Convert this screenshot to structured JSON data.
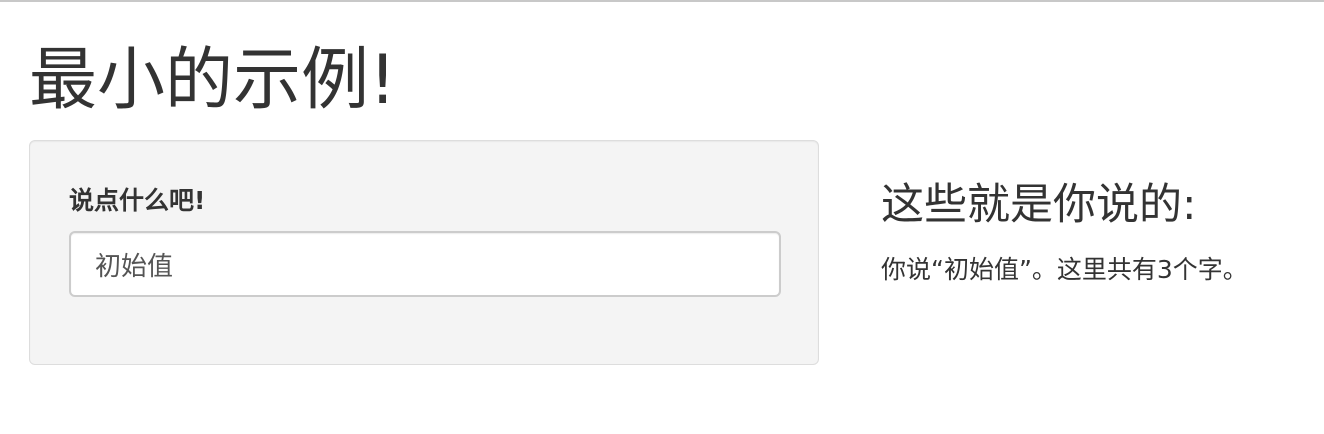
{
  "page": {
    "title": "最小的示例!"
  },
  "input_panel": {
    "label": "说点什么吧!",
    "input_value": "初始值"
  },
  "output_panel": {
    "heading": "这些就是你说的:",
    "text": "你说“初始值”。这里共有3个字。"
  }
}
